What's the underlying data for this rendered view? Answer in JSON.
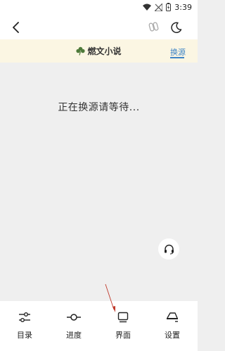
{
  "status_bar": {
    "time": "3:39"
  },
  "top_bar": {
    "back_icon": "chevron-left-icon",
    "clip_icon": "clip-icon",
    "night_icon": "moon-icon"
  },
  "source_bar": {
    "book_title": "燃文小说",
    "switch_source": "换源",
    "accent": "#3d84c6"
  },
  "content": {
    "loading_text": "正在换源请等待..."
  },
  "bottom_nav": {
    "items": [
      {
        "label": "目录",
        "icon": "toc-icon"
      },
      {
        "label": "进度",
        "icon": "progress-icon"
      },
      {
        "label": "界面",
        "icon": "display-icon"
      },
      {
        "label": "设置",
        "icon": "settings-icon"
      }
    ]
  }
}
